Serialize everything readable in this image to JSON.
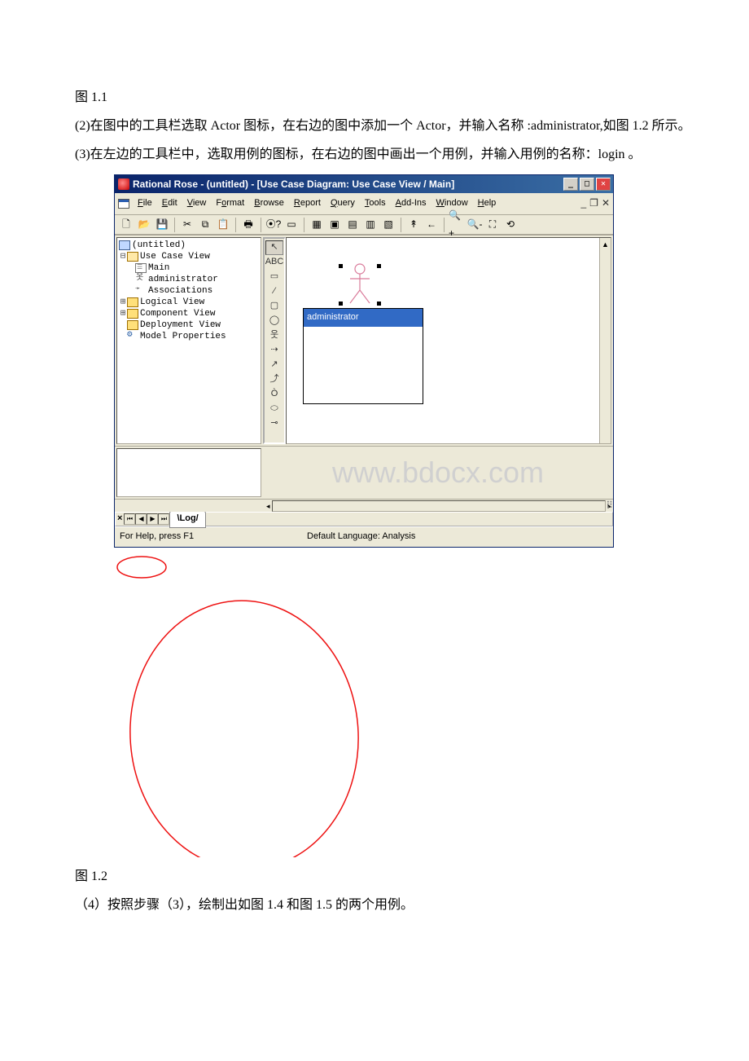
{
  "captions": {
    "fig11": "图 1.1",
    "fig12": "图 1.2"
  },
  "paragraphs": {
    "p2": "(2)在图中的工具栏选取 Actor 图标，在右边的图中添加一个 Actor，并输入名称 :administrator,如图 1.2 所示。",
    "p3": "(3)在左边的工具栏中，选取用例的图标，在右边的图中画出一个用例，并输入用例的名称：login 。",
    "p4": "（4）按照步骤（3），绘制出如图 1.4 和图 1.5 的两个用例。"
  },
  "app": {
    "title": "Rational Rose - (untitled) - [Use Case Diagram: Use Case View / Main]",
    "menus": [
      "File",
      "Edit",
      "View",
      "Format",
      "Browse",
      "Report",
      "Query",
      "Tools",
      "Add-Ins",
      "Window",
      "Help"
    ],
    "tree": {
      "root": "(untitled)",
      "nodes": [
        "Use Case View",
        "Main",
        "administrator",
        "Associations",
        "Logical View",
        "Component View",
        "Deployment View",
        "Model Properties"
      ]
    },
    "palette_labels": {
      "pointer": "↖",
      "text": "ABC",
      "note": "▭",
      "anchor": "⁄",
      "package": "▢",
      "usecase": "◯",
      "actor": "웃",
      "uni_assoc": "⇢",
      "dependency": "↗",
      "generalize": "⤴",
      "assoc_class": "Ò",
      "state": "⬭",
      "hstate": "⊸"
    },
    "canvas": {
      "actor_label": "administrator",
      "input_header": "administrator"
    },
    "watermark": "www.bdocx.com",
    "log_tab": "Log",
    "status": {
      "help": "For Help, press F1",
      "lang": "Default Language: Analysis"
    }
  }
}
